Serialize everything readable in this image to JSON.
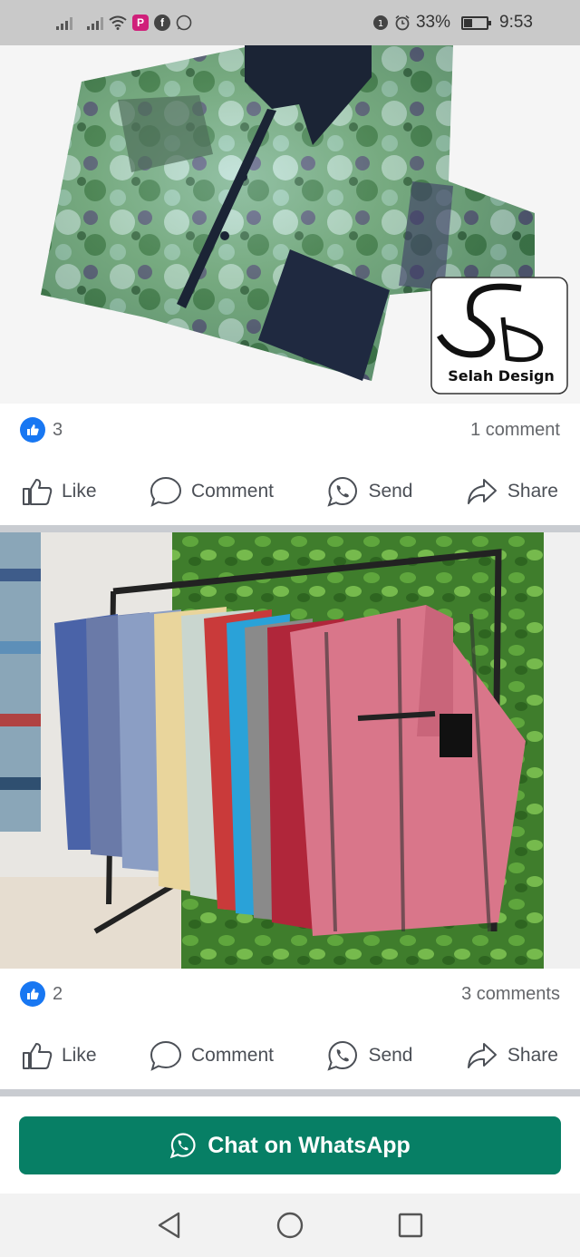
{
  "status_bar": {
    "battery": "33%",
    "time": "9:53",
    "icons": [
      "signal-icon",
      "signal-icon",
      "wifi-icon",
      "p-app-icon",
      "facebook-icon",
      "whatsapp-icon",
      "data-icon",
      "alarm-icon",
      "battery-icon"
    ]
  },
  "posts": [
    {
      "image": {
        "description_icon": "shirt-image",
        "logo_text": "Selah Design"
      },
      "reactions": {
        "count": "3",
        "comments": "1 comment"
      },
      "actions": {
        "like": "Like",
        "comment": "Comment",
        "send": "Send",
        "share": "Share"
      }
    },
    {
      "image": {
        "description_icon": "clothing-rack-image"
      },
      "reactions": {
        "count": "2",
        "comments": "3 comments"
      },
      "actions": {
        "like": "Like",
        "comment": "Comment",
        "send": "Send",
        "share": "Share"
      }
    }
  ],
  "whatsapp_button": {
    "label": "Chat on WhatsApp",
    "color": "#077f65"
  },
  "colors": {
    "like_blue": "#1877f2",
    "status_bar": "#c9c9c9"
  }
}
